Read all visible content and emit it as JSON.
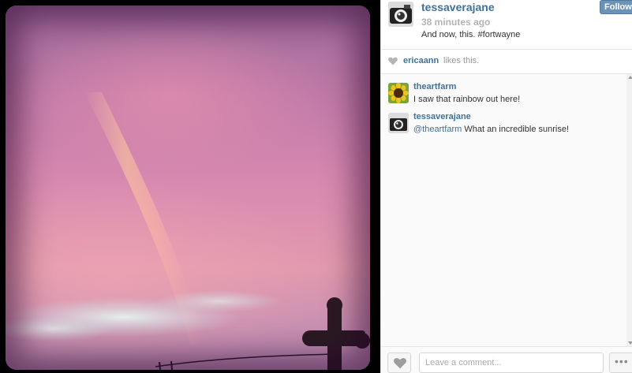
{
  "post": {
    "owner": "tessaverajane",
    "timestamp": "38 minutes ago",
    "caption": "And now, this. #fortwayne",
    "follow_label": "Follow"
  },
  "likes": {
    "user": "ericaann",
    "text": "likes this."
  },
  "comments": [
    {
      "user": "theartfarm",
      "text": "I saw that rainbow out here!",
      "avatar_icon": "sunflower-avatar"
    },
    {
      "user": "tessaverajane",
      "mention": "@theartfarm",
      "text": " What an incredible sunrise!",
      "avatar_icon": "camera-avatar"
    }
  ],
  "footer": {
    "comment_placeholder": "Leave a comment...",
    "more_label": "•••"
  },
  "colors": {
    "username": "#3f729b",
    "follow_button": "#6b93b8"
  }
}
